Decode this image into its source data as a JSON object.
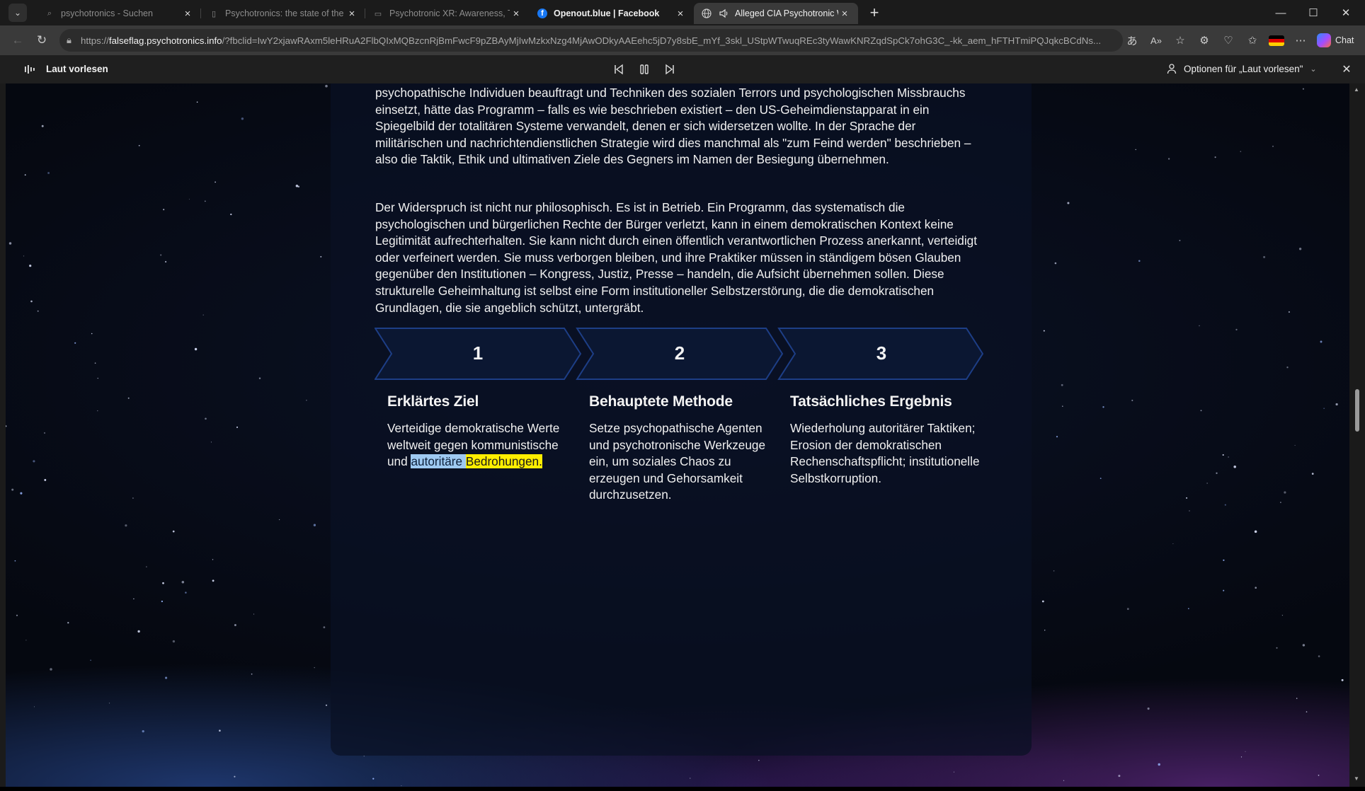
{
  "tabs": [
    {
      "title": "psychotronics - Suchen",
      "icon": "search-icon"
    },
    {
      "title": "Psychotronics: the state of the art",
      "icon": "page-icon"
    },
    {
      "title": "Psychotronic XR: Awareness, Truth",
      "icon": "page-icon"
    },
    {
      "title": "Openout.blue | Facebook",
      "icon": "facebook-icon"
    },
    {
      "title": "Alleged CIA Psychotronic War",
      "icon": "globe-icon",
      "audio": true
    }
  ],
  "address": {
    "prefix": "https://",
    "host": "falseflag.psychotronics.info",
    "path": "/?fbclid=IwY2xjawRAxm5leHRuA2FlbQIxMQBzcnRjBmFwcF9pZBAyMjIwMzkxNzg4MjAwODkyAAEehc5jD7y8sbE_mYf_3skl_UStpWTwuqREc3tyWawKNRZqdSpCk7ohG3C_-kk_aem_hFTHTmiPQJqkcBCdNs..."
  },
  "toolbar": {
    "chat_label": "Chat"
  },
  "read_aloud": {
    "label": "Laut vorlesen",
    "options_label": "Optionen für „Laut vorlesen\""
  },
  "article": {
    "paragraphs": [
      "psychopathische Individuen beauftragt und Techniken des sozialen Terrors und psychologischen Missbrauchs einsetzt, hätte das Programm – falls es wie beschrieben existiert – den US-Geheimdienstapparat in ein Spiegelbild der totalitären Systeme verwandelt, denen er sich widersetzen wollte. In der Sprache der militärischen und nachrichtendienstlichen Strategie wird dies manchmal als \"zum Feind werden\" beschrieben – also die Taktik, Ethik und ultimativen Ziele des Gegners im Namen der Besiegung übernehmen.",
      "Der Widerspruch ist nicht nur philosophisch. Es ist in Betrieb. Ein Programm, das systematisch die psychologischen und bürgerlichen Rechte der Bürger verletzt, kann in einem demokratischen Kontext keine Legitimität aufrechterhalten. Sie kann nicht durch einen öffentlich verantwortlichen Prozess anerkannt, verteidigt oder verfeinert werden. Sie muss verborgen bleiben, und ihre Praktiker müssen in ständigem bösen Glauben gegenüber den Institutionen – Kongress, Justiz, Presse – handeln, die Aufsicht übernehmen sollen. Diese strukturelle Geheimhaltung ist selbst eine Form institutioneller Selbstzerstörung, die die demokratischen Grundlagen, die sie angeblich schützt, untergräbt."
    ],
    "steps": [
      {
        "number": "1",
        "heading": "Erklärtes Ziel",
        "text": "Verteidige demokratische Werte weltweit gegen kommunistische und",
        "highlight_word_1": "autoritäre",
        "highlight_word_2": "Bedrohungen",
        "tail": "."
      },
      {
        "number": "2",
        "heading": "Behauptete Methode",
        "text": "Setze psychopathische Agenten und psychotronische Werkzeuge ein, um soziales Chaos zu erzeugen und Gehorsamkeit durchzusetzen."
      },
      {
        "number": "3",
        "heading": "Tatsächliches Ergebnis",
        "text": "Wiederholung autoritärer Taktiken; Erosion der demokratischen Rechenschaftspflicht; institutionelle Selbstkorruption."
      }
    ]
  },
  "colors": {
    "highlight_current_word": "#ffee00",
    "highlight_sentence": "#9ec9f2",
    "step_border": "#1d3e86"
  }
}
